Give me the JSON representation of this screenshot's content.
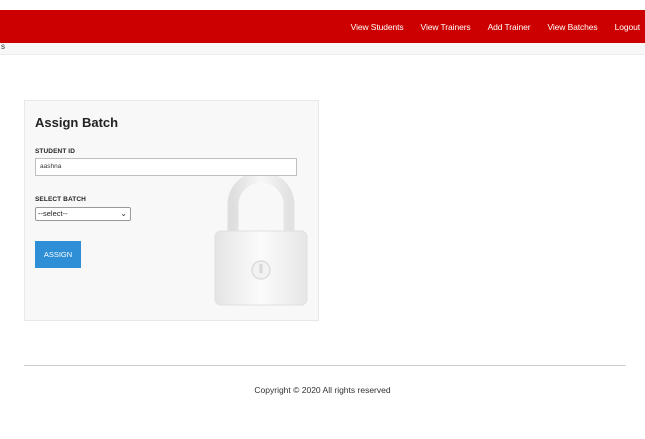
{
  "nav": {
    "items": [
      "View Students",
      "View Trainers",
      "Add Trainer",
      "View Batches",
      "Logout"
    ]
  },
  "subbar": {
    "text": "s"
  },
  "form": {
    "title": "Assign Batch",
    "student_id_label": "STUDENT ID",
    "student_id_value": "aashna",
    "select_batch_label": "SELECT BATCH",
    "select_batch_value": "--select--",
    "assign_button": "ASSIGN",
    "background_icon": "padlock-icon"
  },
  "footer": {
    "copyright": "Copyright © 2020 All rights reserved"
  },
  "colors": {
    "header": "#cc0000",
    "button": "#2e8fd6"
  }
}
